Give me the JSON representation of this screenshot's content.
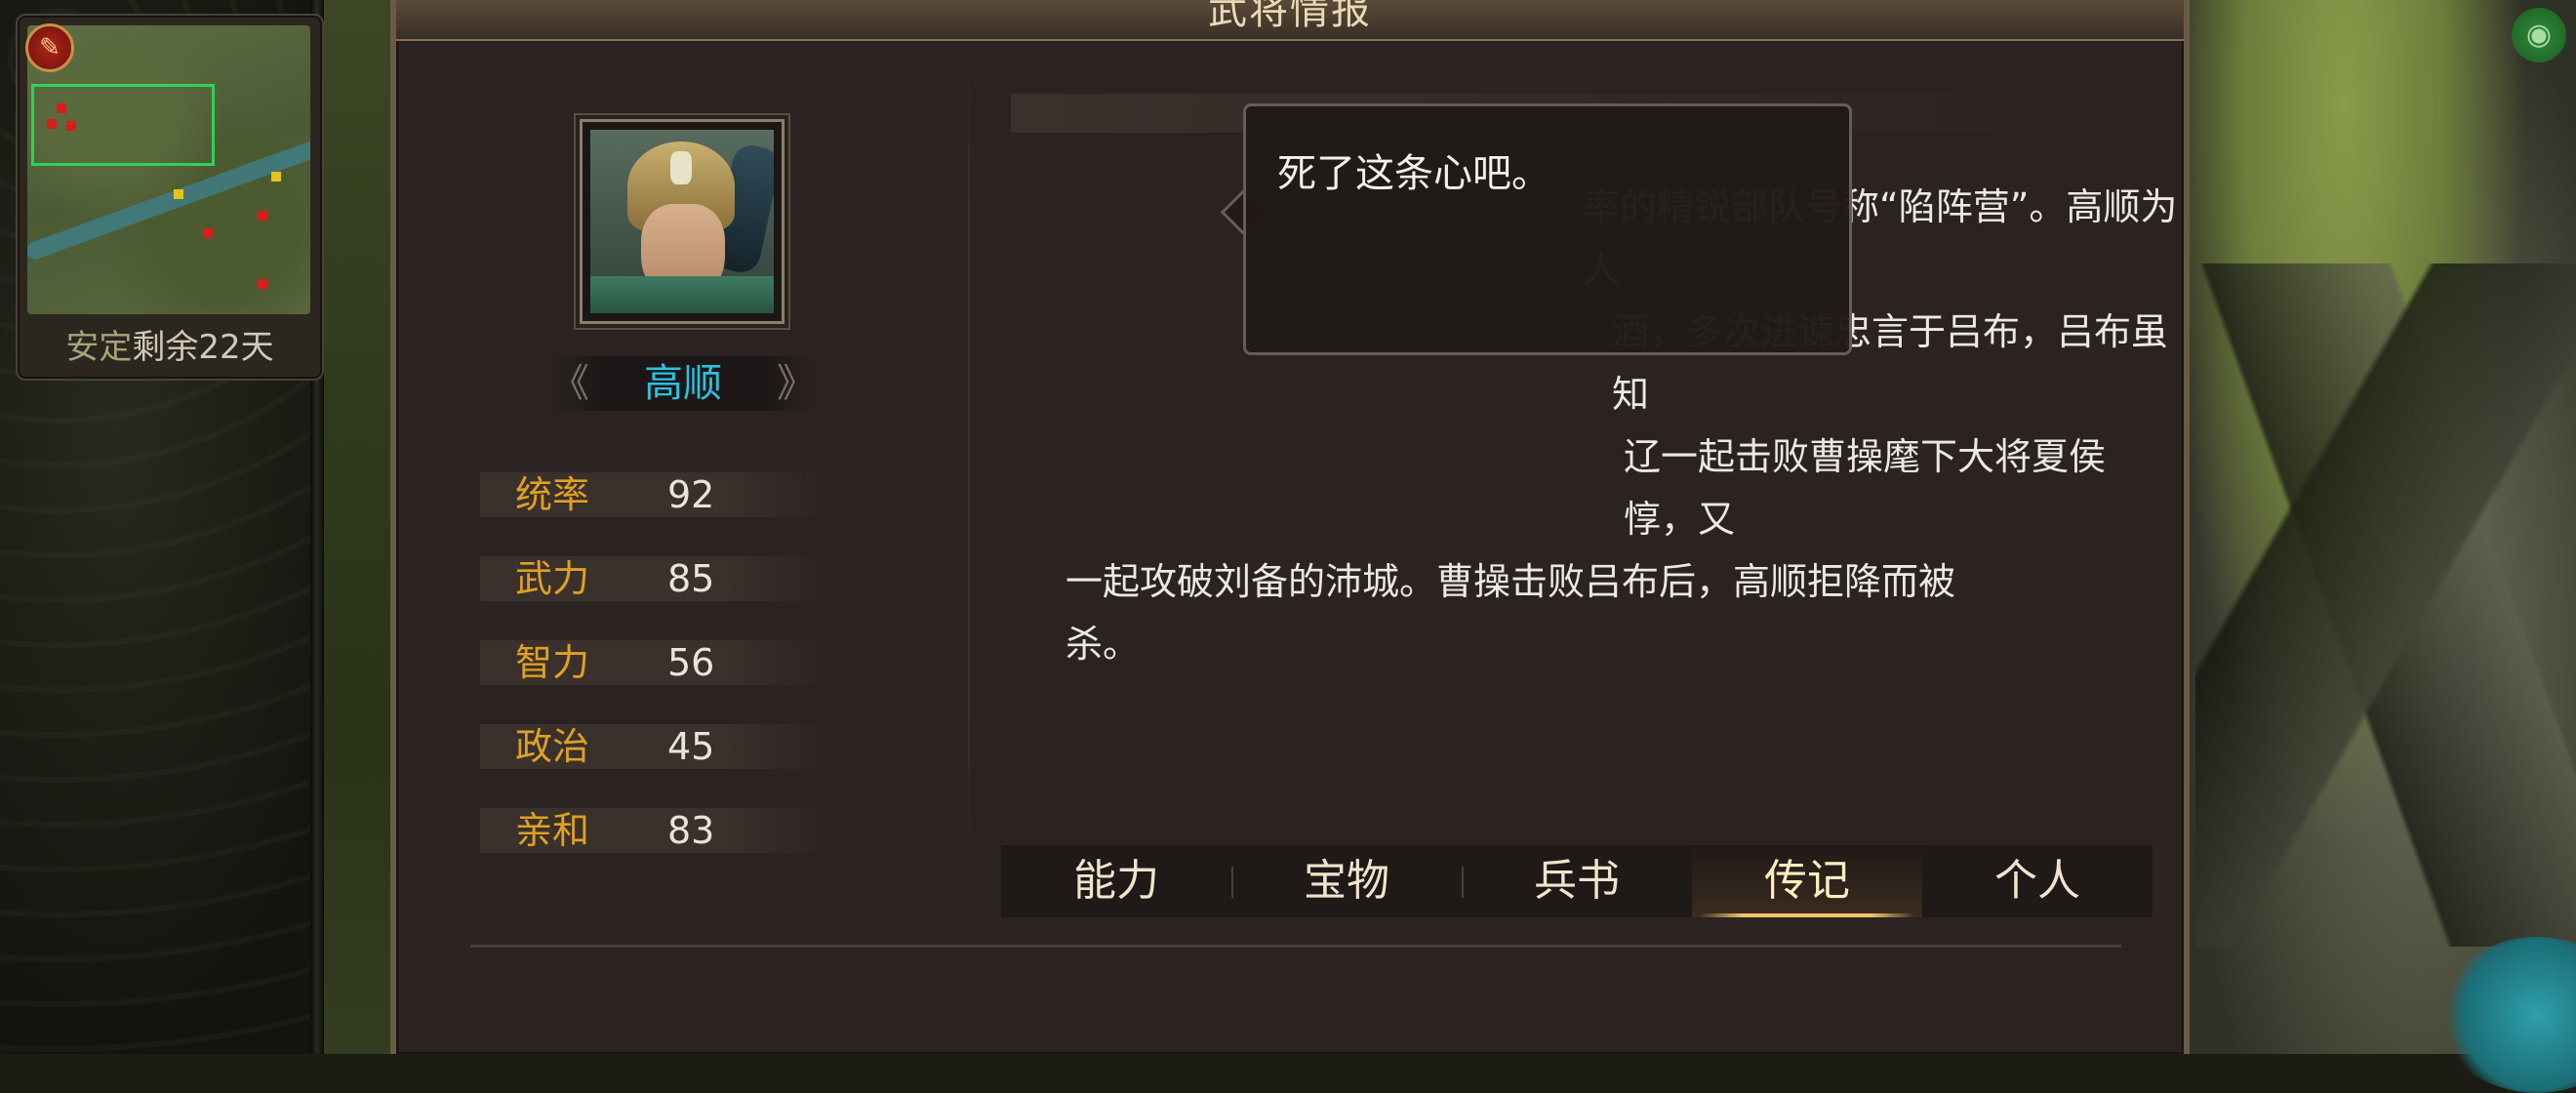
{
  "minimap": {
    "badge_icon": "red-seal-icon",
    "status_label": "安定",
    "remaining_label": "剩余22天"
  },
  "panel": {
    "title": "武将情报"
  },
  "general": {
    "name": "高顺",
    "stats": [
      {
        "label": "统率",
        "value": "92"
      },
      {
        "label": "武力",
        "value": "85"
      },
      {
        "label": "智力",
        "value": "56"
      },
      {
        "label": "政治",
        "value": "45"
      },
      {
        "label": "亲和",
        "value": "83"
      }
    ]
  },
  "bio": {
    "line1": "率的精锐部队号称“陷阵营”。高顺为人",
    "line2": "酒，多次进谏忠言于吕布，吕布虽知",
    "line3": "辽一起击败曹操麾下大将夏侯惇，又",
    "line4": "一起攻破刘备的沛城。曹操击败吕布后，高顺拒降而被",
    "line5": "杀。"
  },
  "bubble": {
    "text": "死了这条心吧。"
  },
  "tabs": [
    {
      "label": "能力"
    },
    {
      "label": "宝物"
    },
    {
      "label": "兵书"
    },
    {
      "label": "传记",
      "active": true
    },
    {
      "label": "个人"
    }
  ],
  "colors": {
    "stat_label": "#e0a022",
    "name": "#2fc0e0",
    "active_tab_underline": "#f2c46b"
  }
}
